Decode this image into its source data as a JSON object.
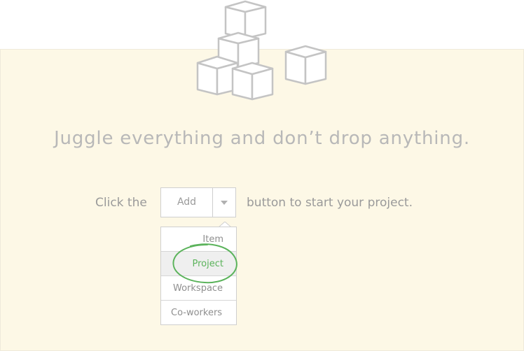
{
  "headline": "Juggle everything and don’t drop anything.",
  "prompt": {
    "before": "Click the",
    "after": "button to start your project."
  },
  "add_button": {
    "label": "Add",
    "caret_icon": "caret-down-icon"
  },
  "menu": {
    "items": [
      {
        "label": "Item"
      },
      {
        "label": "Project",
        "highlighted": true
      },
      {
        "label": "Workspace"
      },
      {
        "label": "Co-workers"
      }
    ]
  },
  "colors": {
    "panel_background": "#fdf8e6",
    "highlight_green": "#5bb35b",
    "muted_text": "#9a9a9a",
    "cube_stroke": "#c4c4c4"
  },
  "icons": [
    "cubes-illustration",
    "caret-down-icon",
    "circle-highlight"
  ]
}
